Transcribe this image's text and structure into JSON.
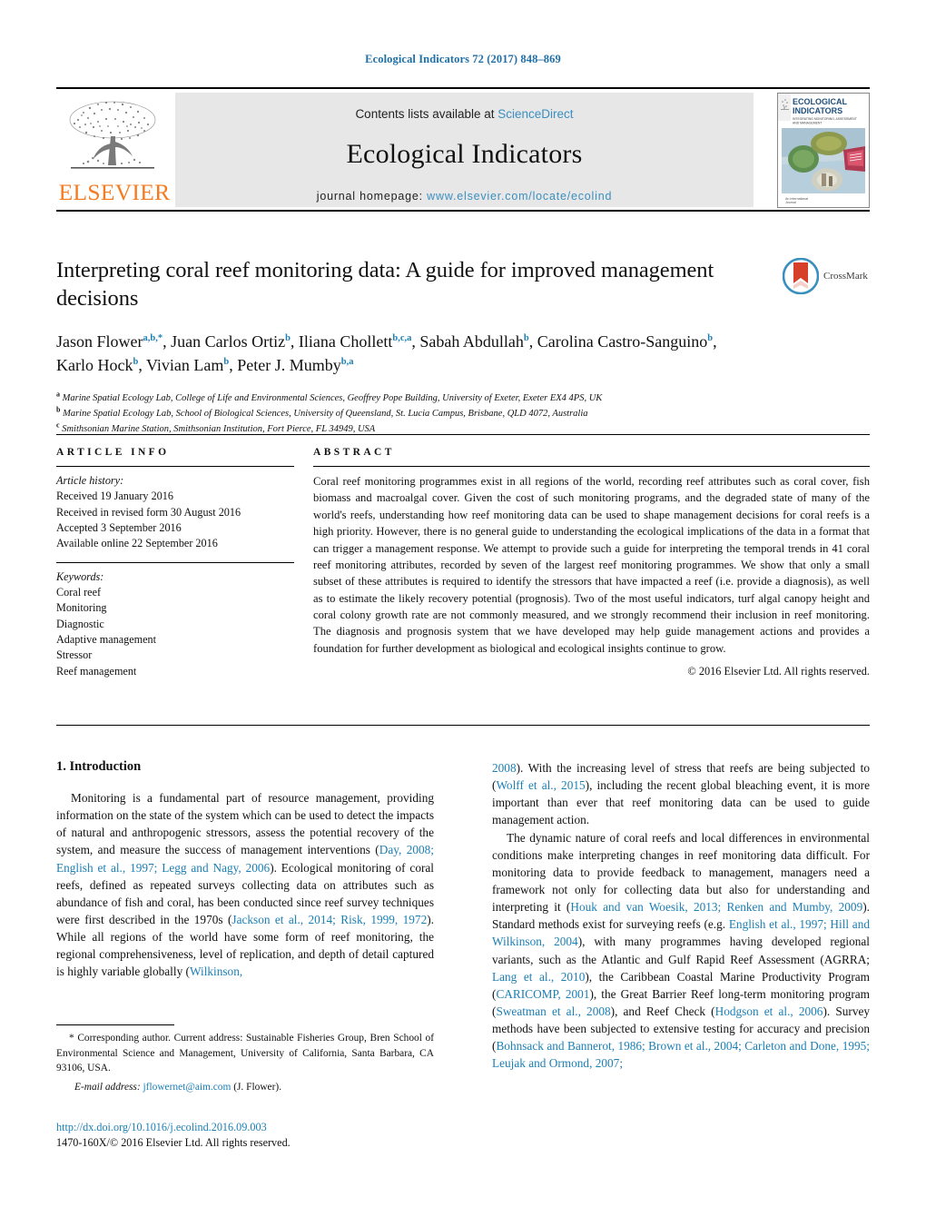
{
  "running_head": "Ecological Indicators 72 (2017) 848–869",
  "masthead": {
    "contents_prefix": "Contents lists available at ",
    "sciencedirect": "ScienceDirect",
    "journal_name": "Ecological Indicators",
    "homepage_label": "journal homepage: ",
    "homepage_url": "www.elsevier.com/locate/ecolind",
    "publisher": "ELSEVIER",
    "cover": {
      "line1": "ECOLOGICAL",
      "line2": "INDICATORS",
      "line3": "INTEGRATING MONITORING, ASSESSMENT AND MANAGEMENT",
      "footer1": "An International",
      "footer2": "Journal"
    }
  },
  "crossmark": {
    "label": "CrossMark"
  },
  "article": {
    "title": "Interpreting coral reef monitoring data: A guide for improved management decisions",
    "authors": [
      {
        "name": "Jason Flower",
        "sup": "a,b,*",
        "sep": ", "
      },
      {
        "name": "Juan Carlos Ortiz",
        "sup": "b",
        "sep": ", "
      },
      {
        "name": "Iliana Chollett",
        "sup": "b,c,a",
        "sep": ", "
      },
      {
        "name": "Sabah Abdullah",
        "sup": "b",
        "sep": ", "
      },
      {
        "name": "Carolina Castro-Sanguino",
        "sup": "b",
        "sep": ", "
      },
      {
        "name": "Karlo Hock",
        "sup": "b",
        "sep": ", "
      },
      {
        "name": "Vivian Lam",
        "sup": "b",
        "sep": ", "
      },
      {
        "name": "Peter J. Mumby",
        "sup": "b,a",
        "sep": ""
      }
    ],
    "affiliations": [
      {
        "marker": "a",
        "text": "Marine Spatial Ecology Lab, College of Life and Environmental Sciences, Geoffrey Pope Building, University of Exeter, Exeter EX4 4PS, UK"
      },
      {
        "marker": "b",
        "text": "Marine Spatial Ecology Lab, School of Biological Sciences, University of Queensland, St. Lucia Campus, Brisbane, QLD 4072, Australia"
      },
      {
        "marker": "c",
        "text": "Smithsonian Marine Station, Smithsonian Institution, Fort Pierce, FL 34949, USA"
      }
    ]
  },
  "article_info": {
    "heading": "ARTICLE INFO",
    "history_label": "Article history:",
    "history": [
      "Received 19 January 2016",
      "Received in revised form 30 August 2016",
      "Accepted 3 September 2016",
      "Available online 22 September 2016"
    ],
    "keywords_label": "Keywords:",
    "keywords": [
      "Coral reef",
      "Monitoring",
      "Diagnostic",
      "Adaptive management",
      "Stressor",
      "Reef management"
    ]
  },
  "abstract": {
    "heading": "ABSTRACT",
    "text": "Coral reef monitoring programmes exist in all regions of the world, recording reef attributes such as coral cover, fish biomass and macroalgal cover. Given the cost of such monitoring programs, and the degraded state of many of the world's reefs, understanding how reef monitoring data can be used to shape management decisions for coral reefs is a high priority. However, there is no general guide to understanding the ecological implications of the data in a format that can trigger a management response. We attempt to provide such a guide for interpreting the temporal trends in 41 coral reef monitoring attributes, recorded by seven of the largest reef monitoring programmes. We show that only a small subset of these attributes is required to identify the stressors that have impacted a reef (i.e. provide a diagnosis), as well as to estimate the likely recovery potential (prognosis). Two of the most useful indicators, turf algal canopy height and coral colony growth rate are not commonly measured, and we strongly recommend their inclusion in reef monitoring. The diagnosis and prognosis system that we have developed may help guide management actions and provides a foundation for further development as biological and ecological insights continue to grow.",
    "copyright": "© 2016 Elsevier Ltd. All rights reserved."
  },
  "body": {
    "section_number_title": "1. Introduction",
    "left_paragraphs": [
      [
        {
          "t": "Monitoring is a fundamental part of resource management, providing information on the state of the system which can be used to detect the impacts of natural and anthropogenic stressors, assess the potential recovery of the system, and measure the success of management interventions (",
          "k": "plain"
        },
        {
          "t": "Day, 2008; English et al., 1997; Legg and Nagy, 2006",
          "k": "ref"
        },
        {
          "t": "). Ecological monitoring of coral reefs, defined as repeated surveys collecting data on attributes such as abundance of fish and coral, has been conducted since reef survey techniques were first described in the 1970s (",
          "k": "plain"
        },
        {
          "t": "Jackson et al., 2014; Risk, 1999, 1972",
          "k": "ref"
        },
        {
          "t": "). While all regions of the world have some form of reef monitoring, the regional comprehensiveness, level of replication, and depth of detail captured is highly variable globally (",
          "k": "plain"
        },
        {
          "t": "Wilkinson,",
          "k": "ref"
        }
      ]
    ],
    "right_paragraphs": [
      [
        {
          "t": "2008",
          "k": "ref"
        },
        {
          "t": "). With the increasing level of stress that reefs are being subjected to (",
          "k": "plain"
        },
        {
          "t": "Wolff et al., 2015",
          "k": "ref"
        },
        {
          "t": "), including the recent global bleaching event, it is more important than ever that reef monitoring data can be used to guide management action.",
          "k": "plain"
        }
      ],
      [
        {
          "t": "The dynamic nature of coral reefs and local differences in environmental conditions make interpreting changes in reef monitoring data difficult. For monitoring data to provide feedback to management, managers need a framework not only for collecting data but also for understanding and interpreting it (",
          "k": "plain"
        },
        {
          "t": "Houk and van Woesik, 2013; Renken and Mumby, 2009",
          "k": "ref"
        },
        {
          "t": "). Standard methods exist for surveying reefs (e.g. ",
          "k": "plain"
        },
        {
          "t": "English et al., 1997; Hill and Wilkinson, 2004",
          "k": "ref"
        },
        {
          "t": "), with many programmes having developed regional variants, such as the Atlantic and Gulf Rapid Reef Assessment (AGRRA; ",
          "k": "plain"
        },
        {
          "t": "Lang et al., 2010",
          "k": "ref"
        },
        {
          "t": "), the Caribbean Coastal Marine Productivity Program (",
          "k": "plain"
        },
        {
          "t": "CARICOMP, 2001",
          "k": "ref"
        },
        {
          "t": "), the Great Barrier Reef long-term monitoring program (",
          "k": "plain"
        },
        {
          "t": "Sweatman et al., 2008",
          "k": "ref"
        },
        {
          "t": "), and Reef Check (",
          "k": "plain"
        },
        {
          "t": "Hodgson et al., 2006",
          "k": "ref"
        },
        {
          "t": "). Survey methods have been subjected to extensive testing for accuracy and precision (",
          "k": "plain"
        },
        {
          "t": "Bohnsack and Bannerot, 1986; Brown et al., 2004; Carleton and Done, 1995; Leujak and Ormond, 2007;",
          "k": "ref"
        }
      ]
    ]
  },
  "footnote": {
    "corresponding": "* Corresponding author. Current address: Sustainable Fisheries Group, Bren School of Environmental Science and Management, University of California, Santa Barbara, CA 93106, USA.",
    "email_label": "E-mail address: ",
    "email": "jflowernet@aim.com",
    "email_suffix": " (J. Flower)."
  },
  "doi": {
    "url": "http://dx.doi.org/10.1016/j.ecolind.2016.09.003",
    "issn_line": "1470-160X/© 2016 Elsevier Ltd. All rights reserved."
  },
  "colors": {
    "link": "#1b7fb5",
    "elsevier_orange": "#F47B20",
    "masthead_bg": "#e7e7e7"
  }
}
